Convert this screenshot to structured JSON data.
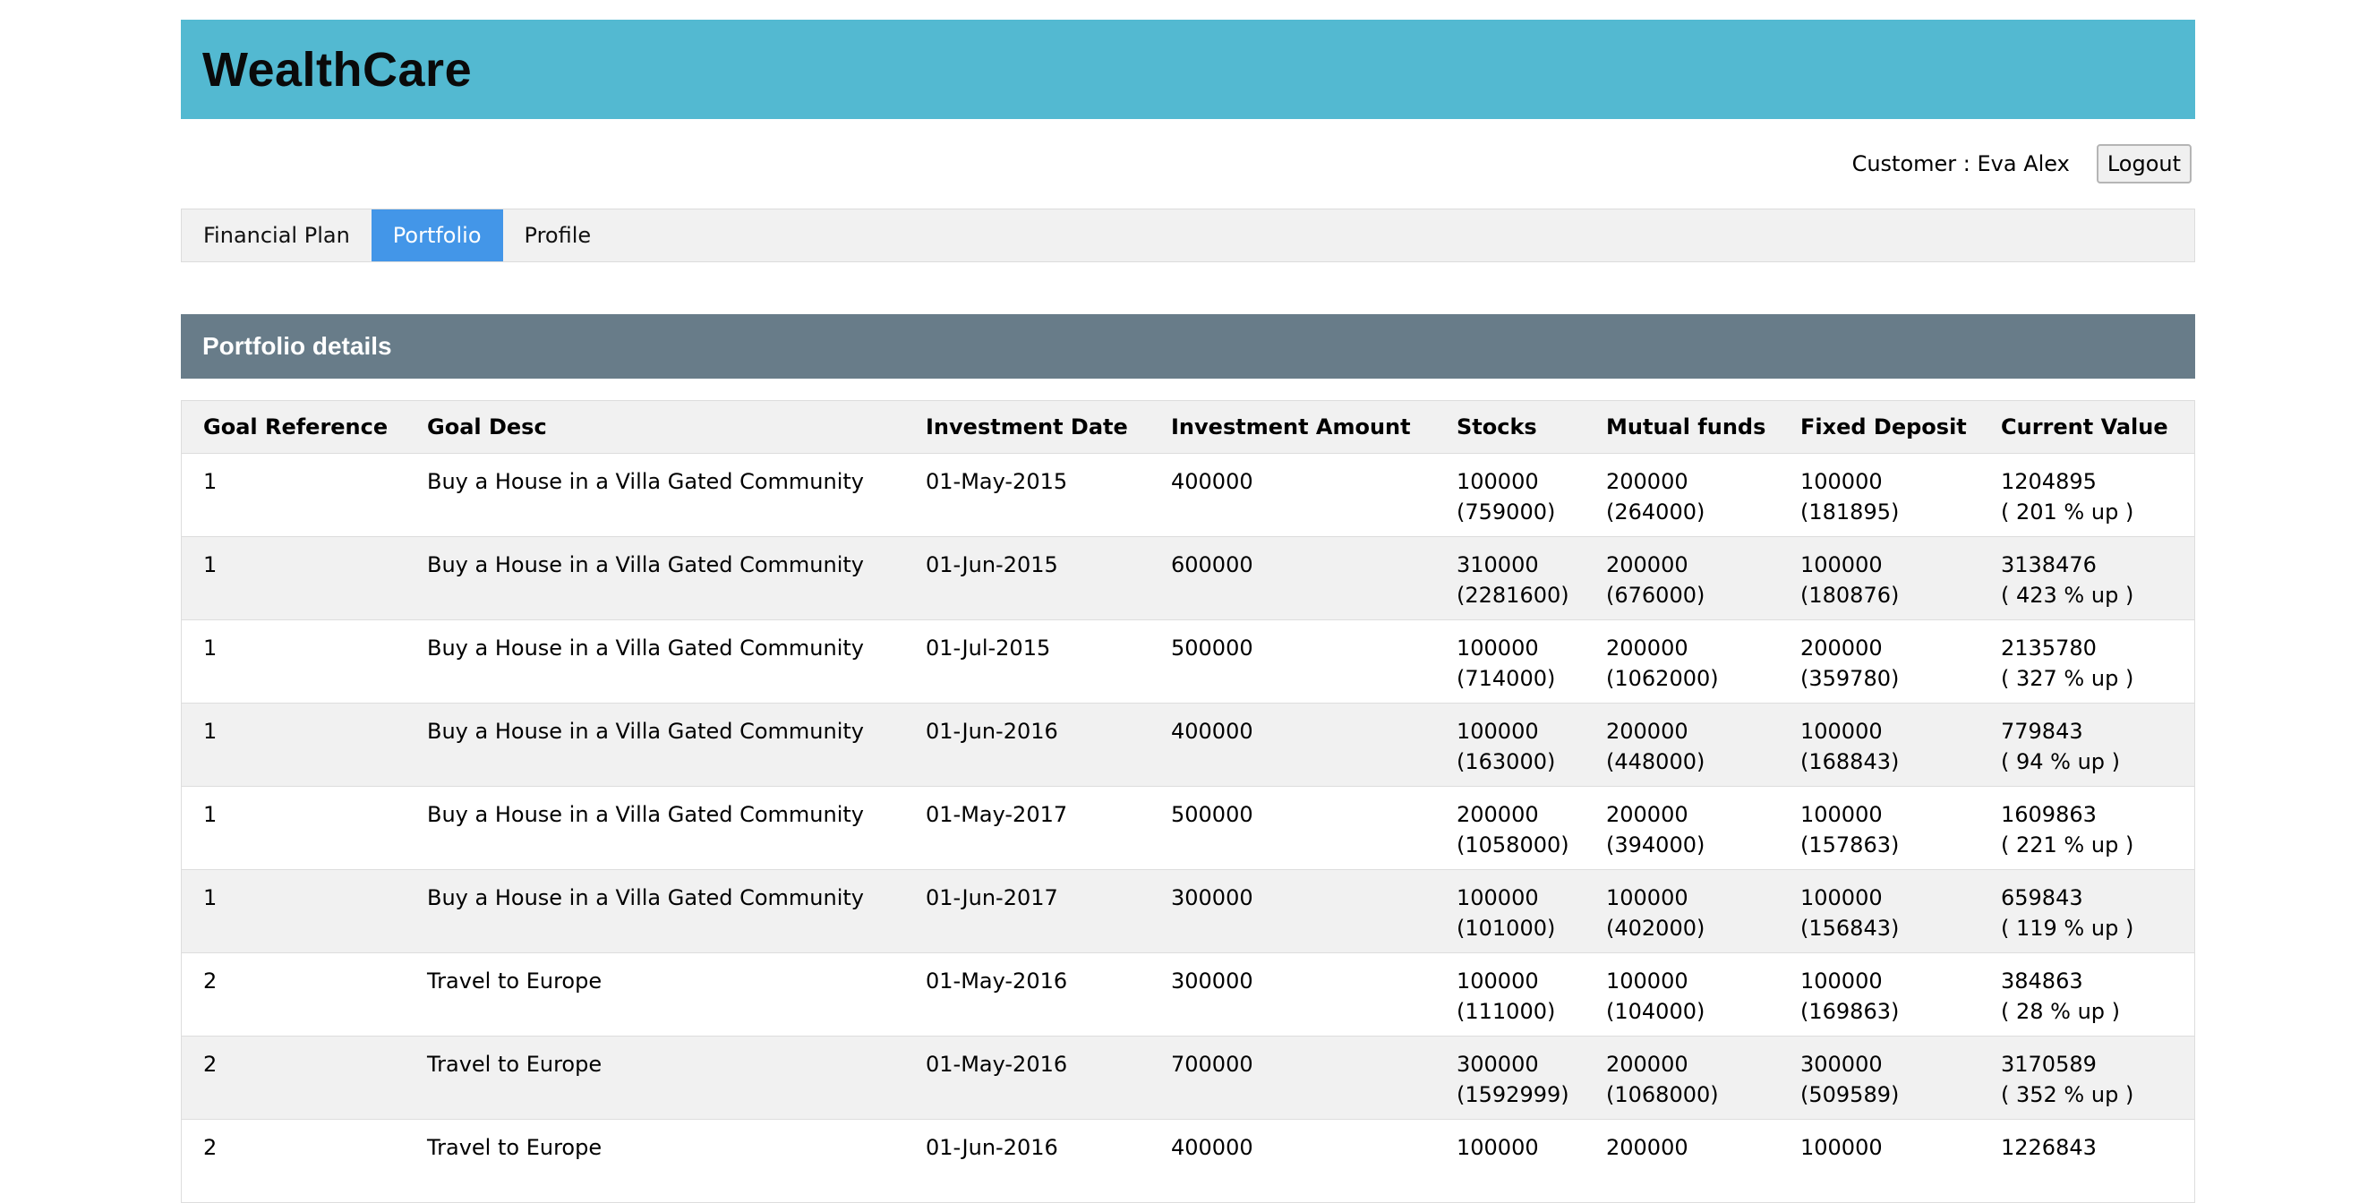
{
  "app": {
    "brand": "WealthCare"
  },
  "user": {
    "customer_label": "Customer : Eva Alex",
    "logout_label": "Logout"
  },
  "nav": {
    "tabs": [
      {
        "label": "Financial Plan",
        "active": false
      },
      {
        "label": "Portfolio",
        "active": true
      },
      {
        "label": "Profile",
        "active": false
      }
    ]
  },
  "portfolio": {
    "title": "Portfolio details",
    "columns": [
      "Goal Reference",
      "Goal Desc",
      "Investment Date",
      "Investment Amount",
      "Stocks",
      "Mutual funds",
      "Fixed Deposit",
      "Current Value"
    ],
    "rows": [
      {
        "ref": "1",
        "desc": "Buy a House in a Villa Gated Community",
        "date": "01-May-2015",
        "amount": "400000",
        "stocks": "100000",
        "stocks_val": "(759000)",
        "mf": "200000",
        "mf_val": "(264000)",
        "fd": "100000",
        "fd_val": "(181895)",
        "current": "1204895",
        "change": "( 201 % up )"
      },
      {
        "ref": "1",
        "desc": "Buy a House in a Villa Gated Community",
        "date": "01-Jun-2015",
        "amount": "600000",
        "stocks": "310000",
        "stocks_val": "(2281600)",
        "mf": "200000",
        "mf_val": "(676000)",
        "fd": "100000",
        "fd_val": "(180876)",
        "current": "3138476",
        "change": "( 423 % up )"
      },
      {
        "ref": "1",
        "desc": "Buy a House in a Villa Gated Community",
        "date": "01-Jul-2015",
        "amount": "500000",
        "stocks": "100000",
        "stocks_val": "(714000)",
        "mf": "200000",
        "mf_val": "(1062000)",
        "fd": "200000",
        "fd_val": "(359780)",
        "current": "2135780",
        "change": "( 327 % up )"
      },
      {
        "ref": "1",
        "desc": "Buy a House in a Villa Gated Community",
        "date": "01-Jun-2016",
        "amount": "400000",
        "stocks": "100000",
        "stocks_val": "(163000)",
        "mf": "200000",
        "mf_val": "(448000)",
        "fd": "100000",
        "fd_val": "(168843)",
        "current": "779843",
        "change": "( 94 % up )"
      },
      {
        "ref": "1",
        "desc": "Buy a House in a Villa Gated Community",
        "date": "01-May-2017",
        "amount": "500000",
        "stocks": "200000",
        "stocks_val": "(1058000)",
        "mf": "200000",
        "mf_val": "(394000)",
        "fd": "100000",
        "fd_val": "(157863)",
        "current": "1609863",
        "change": "( 221 % up )"
      },
      {
        "ref": "1",
        "desc": "Buy a House in a Villa Gated Community",
        "date": "01-Jun-2017",
        "amount": "300000",
        "stocks": "100000",
        "stocks_val": "(101000)",
        "mf": "100000",
        "mf_val": "(402000)",
        "fd": "100000",
        "fd_val": "(156843)",
        "current": "659843",
        "change": "( 119 % up )"
      },
      {
        "ref": "2",
        "desc": "Travel to Europe",
        "date": "01-May-2016",
        "amount": "300000",
        "stocks": "100000",
        "stocks_val": "(111000)",
        "mf": "100000",
        "mf_val": "(104000)",
        "fd": "100000",
        "fd_val": "(169863)",
        "current": "384863",
        "change": "( 28 % up )"
      },
      {
        "ref": "2",
        "desc": "Travel to Europe",
        "date": "01-May-2016",
        "amount": "700000",
        "stocks": "300000",
        "stocks_val": "(1592999)",
        "mf": "200000",
        "mf_val": "(1068000)",
        "fd": "300000",
        "fd_val": "(509589)",
        "current": "3170589",
        "change": "( 352 % up )"
      },
      {
        "ref": "2",
        "desc": "Travel to Europe",
        "date": "01-Jun-2016",
        "amount": "400000",
        "stocks": "100000",
        "stocks_val": "",
        "mf": "200000",
        "mf_val": "",
        "fd": "100000",
        "fd_val": "",
        "current": "1226843",
        "change": ""
      }
    ]
  }
}
